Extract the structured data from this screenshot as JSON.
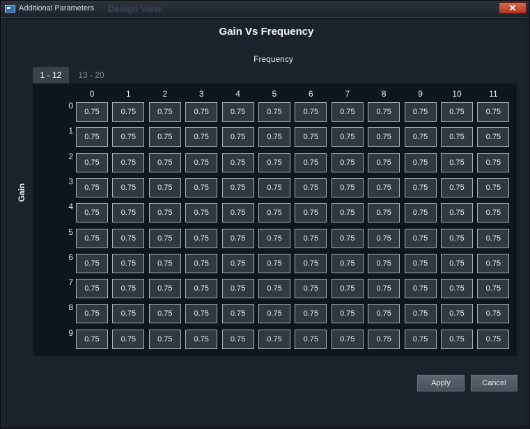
{
  "window": {
    "title": "Additional Parameters",
    "ghost_title": "Design View",
    "close_glyph": "✕"
  },
  "dialog": {
    "title": "Gain Vs Frequency",
    "x_axis_label": "Frequency",
    "y_axis_label": "Gain",
    "tabs": [
      {
        "label": "1 - 12",
        "active": true
      },
      {
        "label": "13 - 20",
        "active": false
      }
    ],
    "columns": [
      "0",
      "1",
      "2",
      "3",
      "4",
      "5",
      "6",
      "7",
      "8",
      "9",
      "10",
      "11"
    ],
    "rows": [
      "0",
      "1",
      "2",
      "3",
      "4",
      "5",
      "6",
      "7",
      "8",
      "9"
    ],
    "values": [
      [
        "0.75",
        "0.75",
        "0.75",
        "0.75",
        "0.75",
        "0.75",
        "0.75",
        "0.75",
        "0.75",
        "0.75",
        "0.75",
        "0.75"
      ],
      [
        "0.75",
        "0.75",
        "0.75",
        "0.75",
        "0.75",
        "0.75",
        "0.75",
        "0.75",
        "0.75",
        "0.75",
        "0.75",
        "0.75"
      ],
      [
        "0.75",
        "0.75",
        "0.75",
        "0.75",
        "0.75",
        "0.75",
        "0.75",
        "0.75",
        "0.75",
        "0.75",
        "0.75",
        "0.75"
      ],
      [
        "0.75",
        "0.75",
        "0.75",
        "0.75",
        "0.75",
        "0.75",
        "0.75",
        "0.75",
        "0.75",
        "0.75",
        "0.75",
        "0.75"
      ],
      [
        "0.75",
        "0.75",
        "0.75",
        "0.75",
        "0.75",
        "0.75",
        "0.75",
        "0.75",
        "0.75",
        "0.75",
        "0.75",
        "0.75"
      ],
      [
        "0.75",
        "0.75",
        "0.75",
        "0.75",
        "0.75",
        "0.75",
        "0.75",
        "0.75",
        "0.75",
        "0.75",
        "0.75",
        "0.75"
      ],
      [
        "0.75",
        "0.75",
        "0.75",
        "0.75",
        "0.75",
        "0.75",
        "0.75",
        "0.75",
        "0.75",
        "0.75",
        "0.75",
        "0.75"
      ],
      [
        "0.75",
        "0.75",
        "0.75",
        "0.75",
        "0.75",
        "0.75",
        "0.75",
        "0.75",
        "0.75",
        "0.75",
        "0.75",
        "0.75"
      ],
      [
        "0.75",
        "0.75",
        "0.75",
        "0.75",
        "0.75",
        "0.75",
        "0.75",
        "0.75",
        "0.75",
        "0.75",
        "0.75",
        "0.75"
      ],
      [
        "0.75",
        "0.75",
        "0.75",
        "0.75",
        "0.75",
        "0.75",
        "0.75",
        "0.75",
        "0.75",
        "0.75",
        "0.75",
        "0.75"
      ]
    ],
    "apply_label": "Apply",
    "cancel_label": "Cancel"
  },
  "colors": {
    "background": "#1b222c",
    "grid_background": "#0f151c",
    "cell_fill": "#303841",
    "close_button": "#c54a34"
  }
}
